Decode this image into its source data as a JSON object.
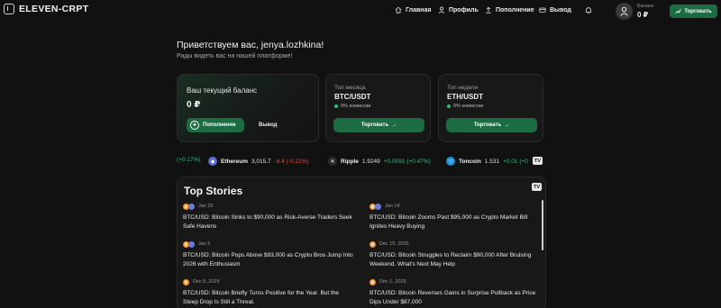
{
  "header": {
    "logo": "ELEVEN-CRPT",
    "nav": [
      {
        "label": "Главная",
        "icon": "home-icon"
      },
      {
        "label": "Профиль",
        "icon": "user-icon"
      },
      {
        "label": "Пополнение",
        "icon": "upload-icon"
      },
      {
        "label": "Вывод",
        "icon": "wallet-icon"
      }
    ],
    "balance_label": "Баланс",
    "balance_value": "0 ₽",
    "trade_button": "Торговать"
  },
  "welcome": {
    "greeting": "Приветствуем вас, jenya.lozhkina!",
    "subtitle": "Рады видеть вас на нашей платформе!"
  },
  "balance_card": {
    "title": "Ваш текущий баланс",
    "value": "0 ₽",
    "deposit_label": "Пополнение",
    "withdraw_label": "Вывод"
  },
  "pair_cards": [
    {
      "period": "Топ месяца",
      "pair": "BTC/USDT",
      "fee": "0% комиссии",
      "button": "Торговать"
    },
    {
      "period": "Топ недели",
      "pair": "ETH/USDT",
      "fee": "0% комиссии",
      "button": "Торговать"
    }
  ],
  "ticker": {
    "lead_change": "(+0.17%)",
    "items": [
      {
        "name": "Ethereum",
        "price": "3,015.7",
        "change": "-6.4 (-0.21%)",
        "dir": "neg",
        "color": "#5b6bd6",
        "glyph": "◆"
      },
      {
        "name": "Ripple",
        "price": "1.9249",
        "change": "+0.0091 (+0.47%)",
        "dir": "pos",
        "color": "#2b2b2b",
        "glyph": "✕"
      },
      {
        "name": "Toncoin",
        "price": "1.531",
        "change": "+0.01 (+0",
        "dir": "pos",
        "color": "#1e90d6",
        "glyph": "▽"
      }
    ],
    "tv_label": "TV"
  },
  "stories": {
    "title": "Top Stories",
    "items": [
      {
        "date": "Jan 20",
        "headline": "BTC/USD: Bitcoin Sinks to $90,000 as Risk-Averse Traders Seek Safe Havens",
        "pair": true
      },
      {
        "date": "Jan 14",
        "headline": "BTC/USD: Bitcoin Zooms Past $95,000 as Crypto Market Bill Ignites Heavy Buying",
        "pair": true
      },
      {
        "date": "Jan 5",
        "headline": "BTC/USD: Bitcoin Pops Above $93,000 as Crypto Bros Jump Into 2026 with Enthusiasm",
        "pair": true
      },
      {
        "date": "Dec 15, 2025",
        "headline": "BTC/USD: Bitcoin Struggles to Reclaim $90,000 After Bruising Weekend. What's Next May Help",
        "pair": false
      },
      {
        "date": "Dec 5, 2025",
        "headline": "BTC/USD: Bitcoin Briefly Turns Positive for the Year. But the Steep Drop Is Still a Threat.",
        "pair": false
      },
      {
        "date": "Dec 1, 2025",
        "headline": "BTC/USD: Bitcoin Reverses Gains in Surprise Pullback as Price Dips Under $87,000",
        "pair": false
      }
    ]
  },
  "colors": {
    "accent": "#1d6b43",
    "positive": "#2fbf71",
    "negative": "#e04a4a",
    "background": "#111111"
  }
}
